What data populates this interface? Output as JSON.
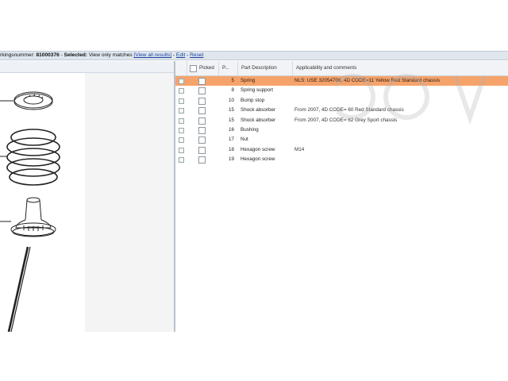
{
  "breadcrumb": {
    "prefix": "rkingsnummer: ",
    "number": "81000376",
    "sep": " - ",
    "selected_label": "Selected:",
    "selected_value": " View only matches ",
    "view_all": "[View all results]",
    "dash1": " - ",
    "edit": "Edit",
    "dash2": " - ",
    "reset": "Reset"
  },
  "table": {
    "headers": {
      "picked": "Picked",
      "pos": "P...",
      "desc": "Part Description",
      "appl": "Applicability and comments"
    },
    "rows": [
      {
        "pos": "5",
        "desc": "Spring",
        "appl": "NLS: USE 32054706, 4D CODE=11 Yellow Red Standard chassis",
        "selected": true
      },
      {
        "pos": "8",
        "desc": "Spring support",
        "appl": ""
      },
      {
        "pos": "10",
        "desc": "Bump stop",
        "appl": ""
      },
      {
        "pos": "15",
        "desc": "Shock absorber",
        "appl": "From 2007, 4D CODE= 60 Red Standard chassis"
      },
      {
        "pos": "15",
        "desc": "Shock absorber",
        "appl": "From 2007, 4D CODE= 62 Grey Sport chassis"
      },
      {
        "pos": "16",
        "desc": "Bushing",
        "appl": ""
      },
      {
        "pos": "17",
        "desc": "Nut",
        "appl": ""
      },
      {
        "pos": "18",
        "desc": "Hexagon screw",
        "appl": "M14"
      },
      {
        "pos": "19",
        "desc": "Hexagon screw",
        "appl": ""
      }
    ]
  },
  "colors": {
    "selected_row": "#f6a36b",
    "link": "#1a3f9e",
    "header_bg": "#dfe6ee"
  },
  "icons": {
    "expander": "plus-expander-icon",
    "watermark": "watermark-logo"
  }
}
